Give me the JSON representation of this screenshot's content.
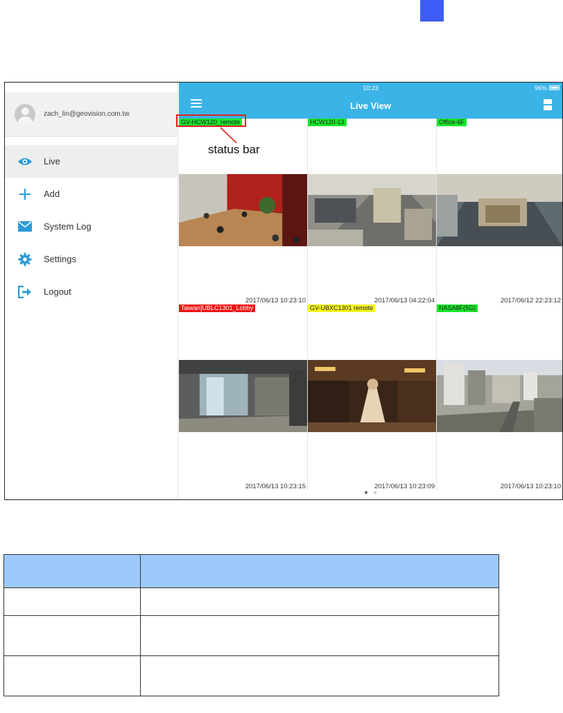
{
  "colors": {
    "topbar": "#3ab3e6",
    "accent": "#3d5cf5",
    "label_green": "#18e62b",
    "label_red": "#ee1111",
    "label_yellow": "#f5f51c",
    "callout": "#e02222",
    "table_header": "#9ccafa"
  },
  "sidebar": {
    "account_email": "zach_lin@geovision.com.tw",
    "items": [
      {
        "label": "Live",
        "icon": "eye-icon",
        "active": true
      },
      {
        "label": "Add",
        "icon": "plus-icon"
      },
      {
        "label": "System Log",
        "icon": "envelope-icon"
      },
      {
        "label": "Settings",
        "icon": "gear-icon"
      },
      {
        "label": "Logout",
        "icon": "logout-icon"
      }
    ]
  },
  "topbar": {
    "time": "10:23",
    "battery": "96%",
    "title": "Live View"
  },
  "cameras": [
    {
      "name": "GV-HCW120_remote",
      "status": "green",
      "timestamp": "2017/06/13 10:23:10"
    },
    {
      "name": "HCW120-13",
      "status": "green",
      "timestamp": "2017/06/13 04:22:04"
    },
    {
      "name": "Office-6F",
      "status": "green",
      "timestamp": "2017/06/12 22:23:12"
    },
    {
      "name": "Taiwan]UBLC1301_Lobby",
      "status": "red",
      "timestamp": "2017/06/13 10:23:15"
    },
    {
      "name": "GV-UBXC1301 remote",
      "status": "yellow",
      "timestamp": "2017/06/13 10:23:09"
    },
    {
      "name": "NASA8F(5G)",
      "status": "green",
      "timestamp": "2017/06/13 10:23:10"
    }
  ],
  "callout": {
    "text": "status bar"
  },
  "pager": {
    "pages": 2,
    "current": 1
  }
}
